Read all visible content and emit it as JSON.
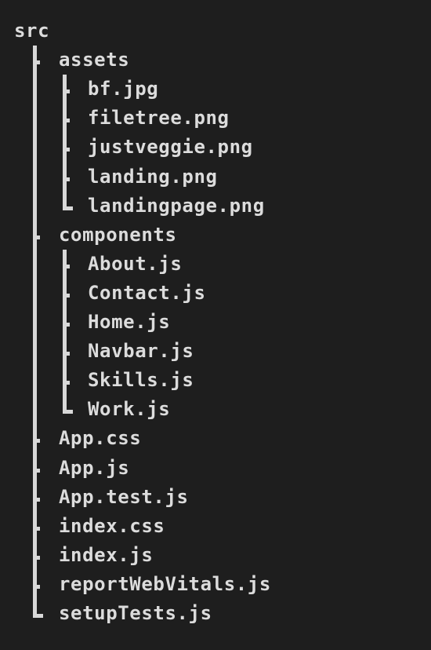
{
  "tree": {
    "root": "src",
    "items": [
      {
        "label": "assets",
        "depth": 1,
        "last": false
      },
      {
        "label": "bf.jpg",
        "depth": 2,
        "last": false
      },
      {
        "label": "filetree.png",
        "depth": 2,
        "last": false
      },
      {
        "label": "justveggie.png",
        "depth": 2,
        "last": false
      },
      {
        "label": "landing.png",
        "depth": 2,
        "last": false
      },
      {
        "label": "landingpage.png",
        "depth": 2,
        "last": true
      },
      {
        "label": "components",
        "depth": 1,
        "last": false
      },
      {
        "label": "About.js",
        "depth": 2,
        "last": false
      },
      {
        "label": "Contact.js",
        "depth": 2,
        "last": false
      },
      {
        "label": "Home.js",
        "depth": 2,
        "last": false
      },
      {
        "label": "Navbar.js",
        "depth": 2,
        "last": false
      },
      {
        "label": "Skills.js",
        "depth": 2,
        "last": false
      },
      {
        "label": "Work.js",
        "depth": 2,
        "last": true
      },
      {
        "label": "App.css",
        "depth": 1,
        "last": false
      },
      {
        "label": "App.js",
        "depth": 1,
        "last": false
      },
      {
        "label": "App.test.js",
        "depth": 1,
        "last": false
      },
      {
        "label": "index.css",
        "depth": 1,
        "last": false
      },
      {
        "label": "index.js",
        "depth": 1,
        "last": false
      },
      {
        "label": "reportWebVitals.js",
        "depth": 1,
        "last": false
      },
      {
        "label": "setupTests.js",
        "depth": 1,
        "last": true
      }
    ]
  },
  "colors": {
    "background": "#1e1e1e",
    "text": "#dcdcdc",
    "branch": "#d8d8d8"
  }
}
